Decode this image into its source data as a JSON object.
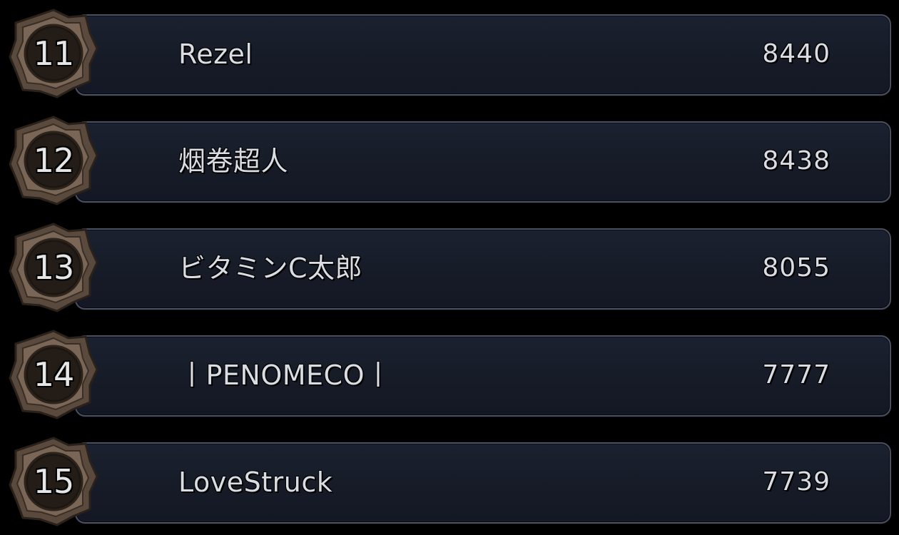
{
  "leaderboard": {
    "rows": [
      {
        "rank": "11",
        "name": "Rezel",
        "score": "8440"
      },
      {
        "rank": "12",
        "name": "烟卷超人",
        "score": "8438"
      },
      {
        "rank": "13",
        "name": "ビタミンC太郎",
        "score": "8055"
      },
      {
        "rank": "14",
        "name": "丨PENOMECO丨",
        "score": "7777"
      },
      {
        "rank": "15",
        "name": "LoveStruck",
        "score": "7739"
      }
    ]
  },
  "colors": {
    "background": "#000000",
    "bar_fill": "#171c28",
    "bar_border": "#4a5060",
    "text": "#d9dde3",
    "badge_frame": "#6b5a4c",
    "badge_inner": "#1a1410"
  },
  "icons": {
    "rank_badge": "ornate-frame-badge-icon"
  }
}
